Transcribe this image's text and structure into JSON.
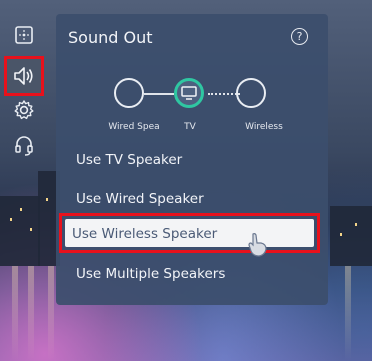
{
  "panel": {
    "title": "Sound Out",
    "help_glyph": "?"
  },
  "diagram": {
    "nodes": [
      {
        "label": "Wired Spea"
      },
      {
        "label": "TV"
      },
      {
        "label": "Wireless"
      }
    ],
    "tv_ring_color": "#2fc7a2"
  },
  "options": {
    "tv": "Use TV Speaker",
    "wired": "Use Wired Speaker",
    "wireless": "Use Wireless Speaker",
    "multiple": "Use Multiple Speakers"
  },
  "rail": {
    "items": [
      {
        "icon": "picture-mode-icon"
      },
      {
        "icon": "speaker-icon",
        "selected": true
      },
      {
        "icon": "settings-gear-icon"
      },
      {
        "icon": "headset-icon"
      }
    ]
  },
  "colors": {
    "highlight_border": "#e8111c",
    "panel_bg": "#3c4e6c"
  }
}
